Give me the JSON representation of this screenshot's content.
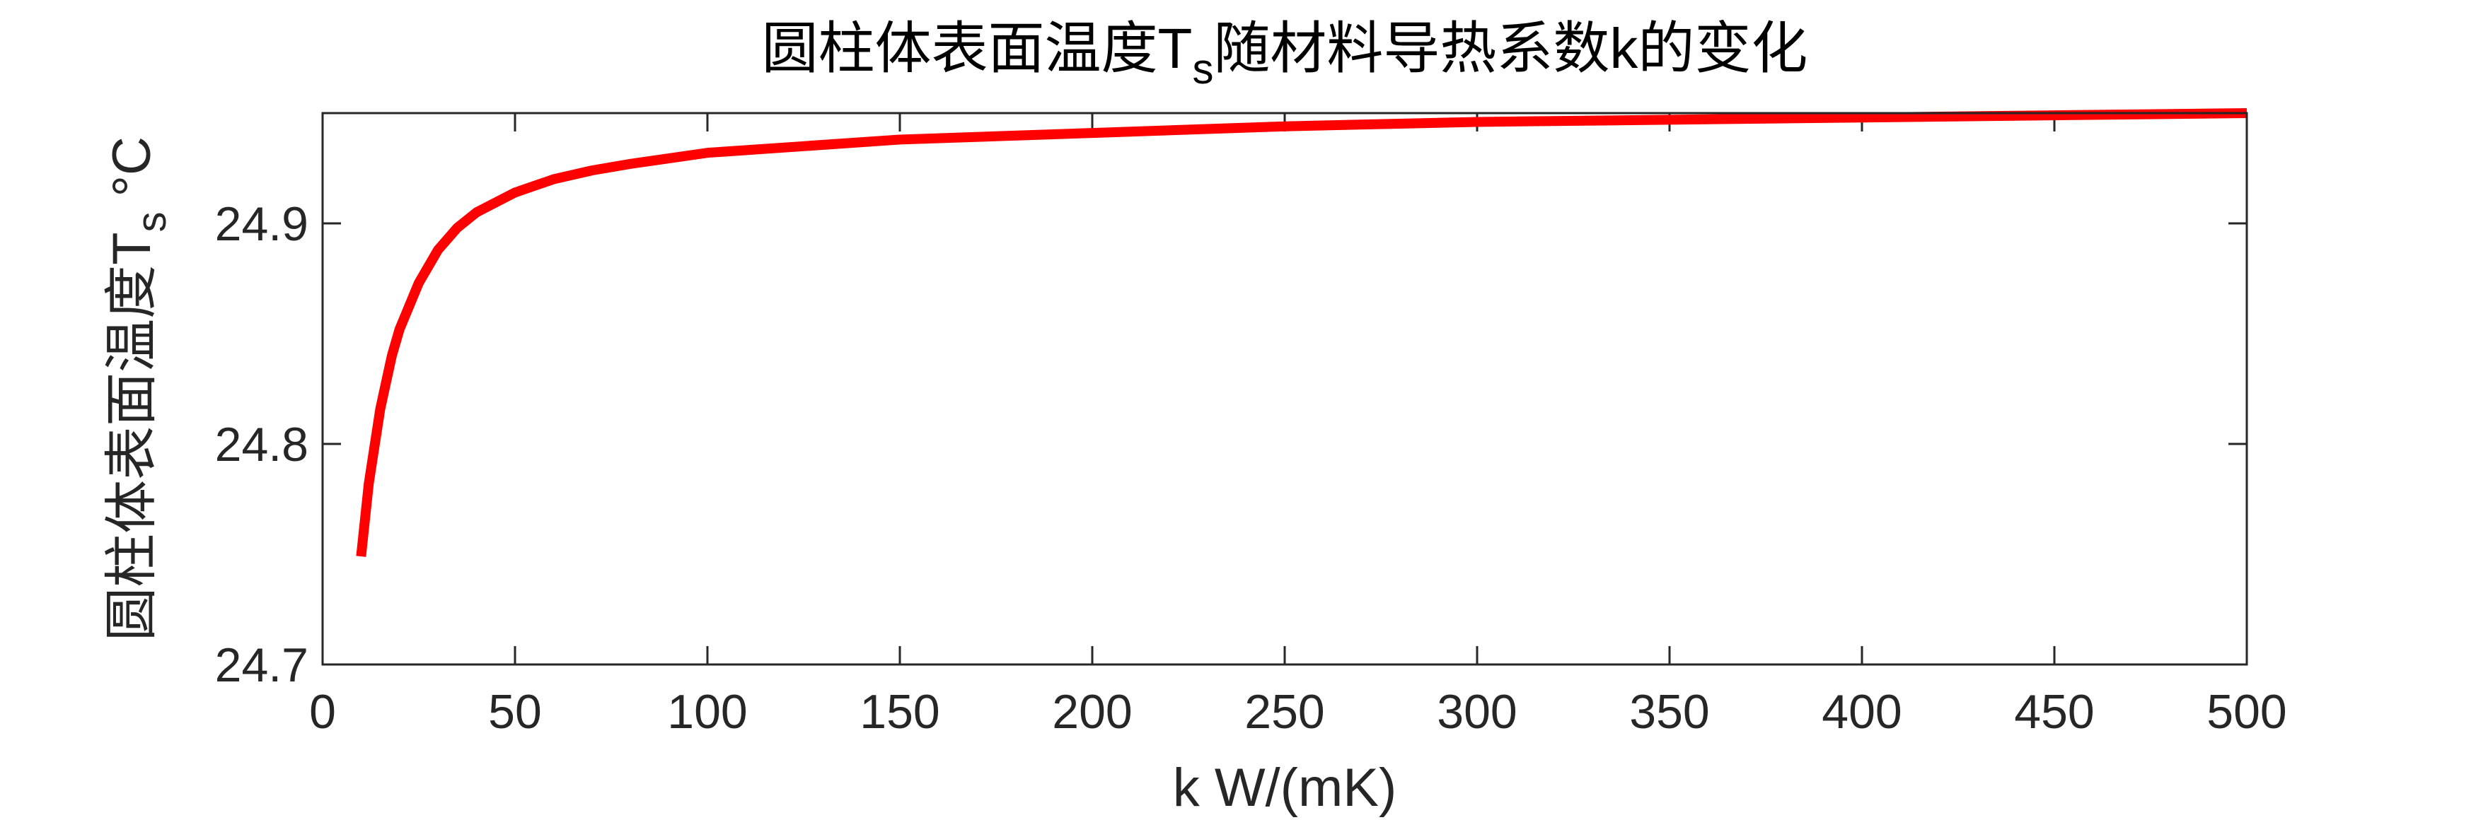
{
  "chart_data": {
    "type": "line",
    "title": "圆柱体表面温度T",
    "title_subscript": "s",
    "title_suffix": "随材料导热系数k的变化",
    "xlabel": "k W/(mK)",
    "ylabel": "圆柱体表面温度T",
    "ylabel_subscript": "s",
    "ylabel_suffix": " °C",
    "xlim": [
      0,
      500
    ],
    "ylim": [
      24.7,
      24.95
    ],
    "xticks": [
      0,
      50,
      100,
      150,
      200,
      250,
      300,
      350,
      400,
      450,
      500
    ],
    "xtick_labels": [
      "0",
      "50",
      "100",
      "150",
      "200",
      "250",
      "300",
      "350",
      "400",
      "450",
      "500"
    ],
    "yticks": [
      24.7,
      24.8,
      24.9
    ],
    "ytick_labels": [
      "24.7",
      "24.8",
      "24.9"
    ],
    "grid": false,
    "series": [
      {
        "color": "#ff0000",
        "x": [
          10,
          12,
          15,
          18,
          20,
          25,
          30,
          35,
          40,
          50,
          60,
          70,
          80,
          100,
          125,
          150,
          200,
          250,
          300,
          350,
          400,
          450,
          500
        ],
        "y": [
          24.749,
          24.782,
          24.816,
          24.84,
          24.852,
          24.873,
          24.888,
          24.898,
          24.905,
          24.914,
          24.92,
          24.924,
          24.927,
          24.932,
          24.935,
          24.938,
          24.941,
          24.944,
          24.946,
          24.947,
          24.948,
          24.949,
          24.95
        ]
      }
    ]
  }
}
